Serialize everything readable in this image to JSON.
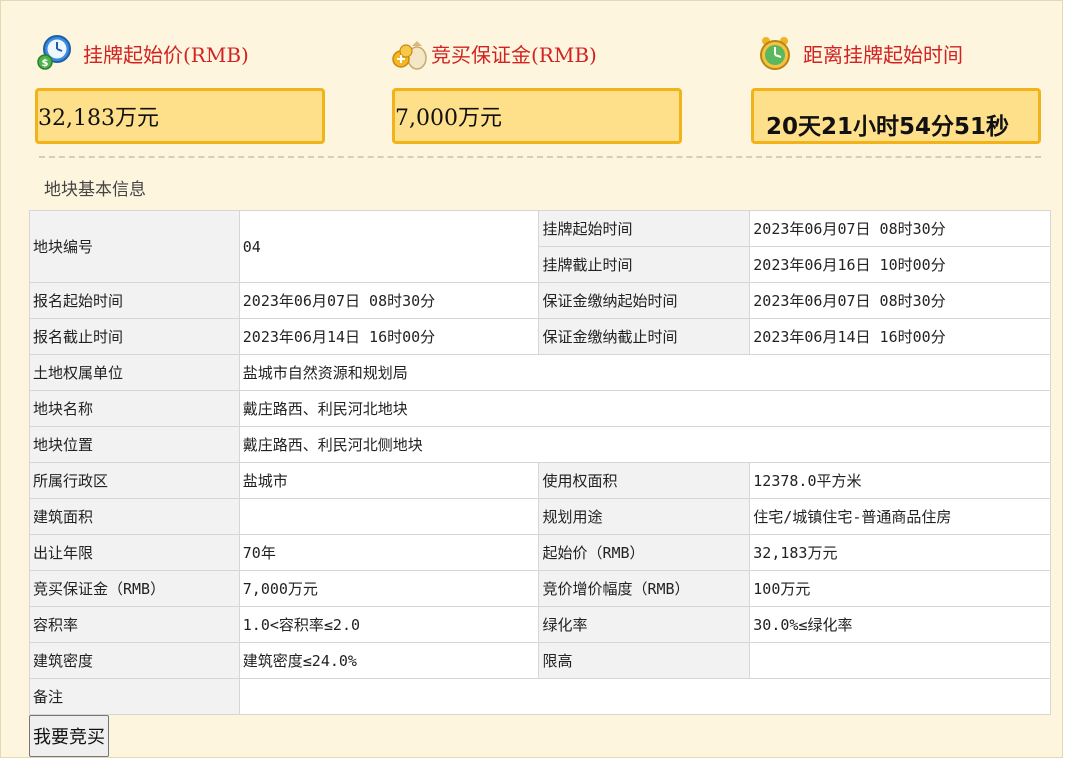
{
  "stats": [
    {
      "label": "挂牌起始价(RMB)",
      "value": "32,183万元",
      "icon": "clock-money-icon"
    },
    {
      "label": "竞买保证金(RMB)",
      "value": "7,000万元",
      "icon": "coins-bag-icon"
    },
    {
      "label": "距离挂牌起始时间",
      "value": "20天21小时54分51秒",
      "icon": "alarm-clock-icon"
    }
  ],
  "section_title": "地块基本信息",
  "table": {
    "parcel_no": {
      "label": "地块编号",
      "value": "04"
    },
    "listing_start": {
      "label": "挂牌起始时间",
      "value": "2023年06月07日 08时30分"
    },
    "listing_end": {
      "label": "挂牌截止时间",
      "value": "2023年06月16日 10时00分"
    },
    "reg_start": {
      "label": "报名起始时间",
      "value": "2023年06月07日 08时30分"
    },
    "deposit_start": {
      "label": "保证金缴纳起始时间",
      "value": "2023年06月07日 08时30分"
    },
    "reg_end": {
      "label": "报名截止时间",
      "value": "2023年06月14日 16时00分"
    },
    "deposit_end": {
      "label": "保证金缴纳截止时间",
      "value": "2023年06月14日 16时00分"
    },
    "owner": {
      "label": "土地权属单位",
      "value": "盐城市自然资源和规划局"
    },
    "name": {
      "label": "地块名称",
      "value": "戴庄路西、利民河北地块"
    },
    "location": {
      "label": "地块位置",
      "value": "戴庄路西、利民河北侧地块"
    },
    "district": {
      "label": "所属行政区",
      "value": "盐城市"
    },
    "area": {
      "label": "使用权面积",
      "value": "12378.0平方米"
    },
    "building_area": {
      "label": "建筑面积",
      "value": ""
    },
    "usage": {
      "label": "规划用途",
      "value": "住宅/城镇住宅-普通商品住房"
    },
    "term": {
      "label": "出让年限",
      "value": "70年"
    },
    "start_price": {
      "label": "起始价（RMB）",
      "value": "32,183万元"
    },
    "deposit": {
      "label": "竞买保证金（RMB）",
      "value": "7,000万元"
    },
    "increment": {
      "label": "竞价增价幅度（RMB）",
      "value": "100万元"
    },
    "far": {
      "label": "容积率",
      "value": "1.0<容积率≤2.0"
    },
    "green": {
      "label": "绿化率",
      "value": "30.0%≤绿化率"
    },
    "density": {
      "label": "建筑密度",
      "value": "建筑密度≤24.0%"
    },
    "height": {
      "label": "限高",
      "value": ""
    },
    "remark": {
      "label": "备注",
      "value": ""
    }
  },
  "bid_button_label": "我要竞买",
  "colors": {
    "panel_bg": "#fdf5de",
    "stat_label": "#d22323",
    "stat_box_bg": "#ffe08a",
    "stat_box_border": "#f2b21a"
  }
}
